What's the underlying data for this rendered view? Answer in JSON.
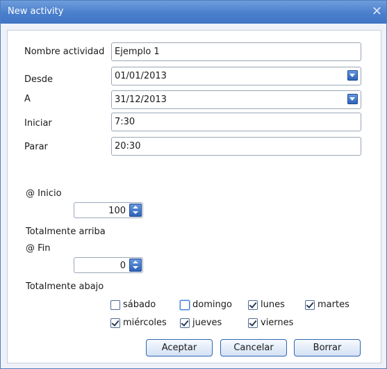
{
  "window": {
    "title": "New activity",
    "close_glyph": "✕"
  },
  "form": {
    "nombre": {
      "label": "Nombre actividad",
      "value": "Ejemplo 1"
    },
    "desde": {
      "label": "Desde",
      "value": "01/01/2013"
    },
    "a": {
      "label": "A",
      "value": "31/12/2013"
    },
    "iniciar": {
      "label": "Iniciar",
      "value": "7:30"
    },
    "parar": {
      "label": "Parar",
      "value": "20:30"
    },
    "inicio": {
      "label": "@ Inicio",
      "value": "100",
      "note": "Totalmente arriba"
    },
    "fin": {
      "label": "@ Fin",
      "value": "0",
      "note": "Totalmente abajo"
    }
  },
  "days": [
    {
      "label": "sábado",
      "checked": false
    },
    {
      "label": "domingo",
      "checked": false
    },
    {
      "label": "lunes",
      "checked": true
    },
    {
      "label": "martes",
      "checked": true
    },
    {
      "label": "miércoles",
      "checked": true
    },
    {
      "label": "jueves",
      "checked": true
    },
    {
      "label": "viernes",
      "checked": true
    }
  ],
  "buttons": {
    "accept": "Aceptar",
    "cancel": "Cancelar",
    "delete": "Borrar"
  },
  "colors": {
    "title_bar": "#4a7fcc",
    "accent": "#2a5fb6",
    "button_border": "#2f63b3"
  }
}
